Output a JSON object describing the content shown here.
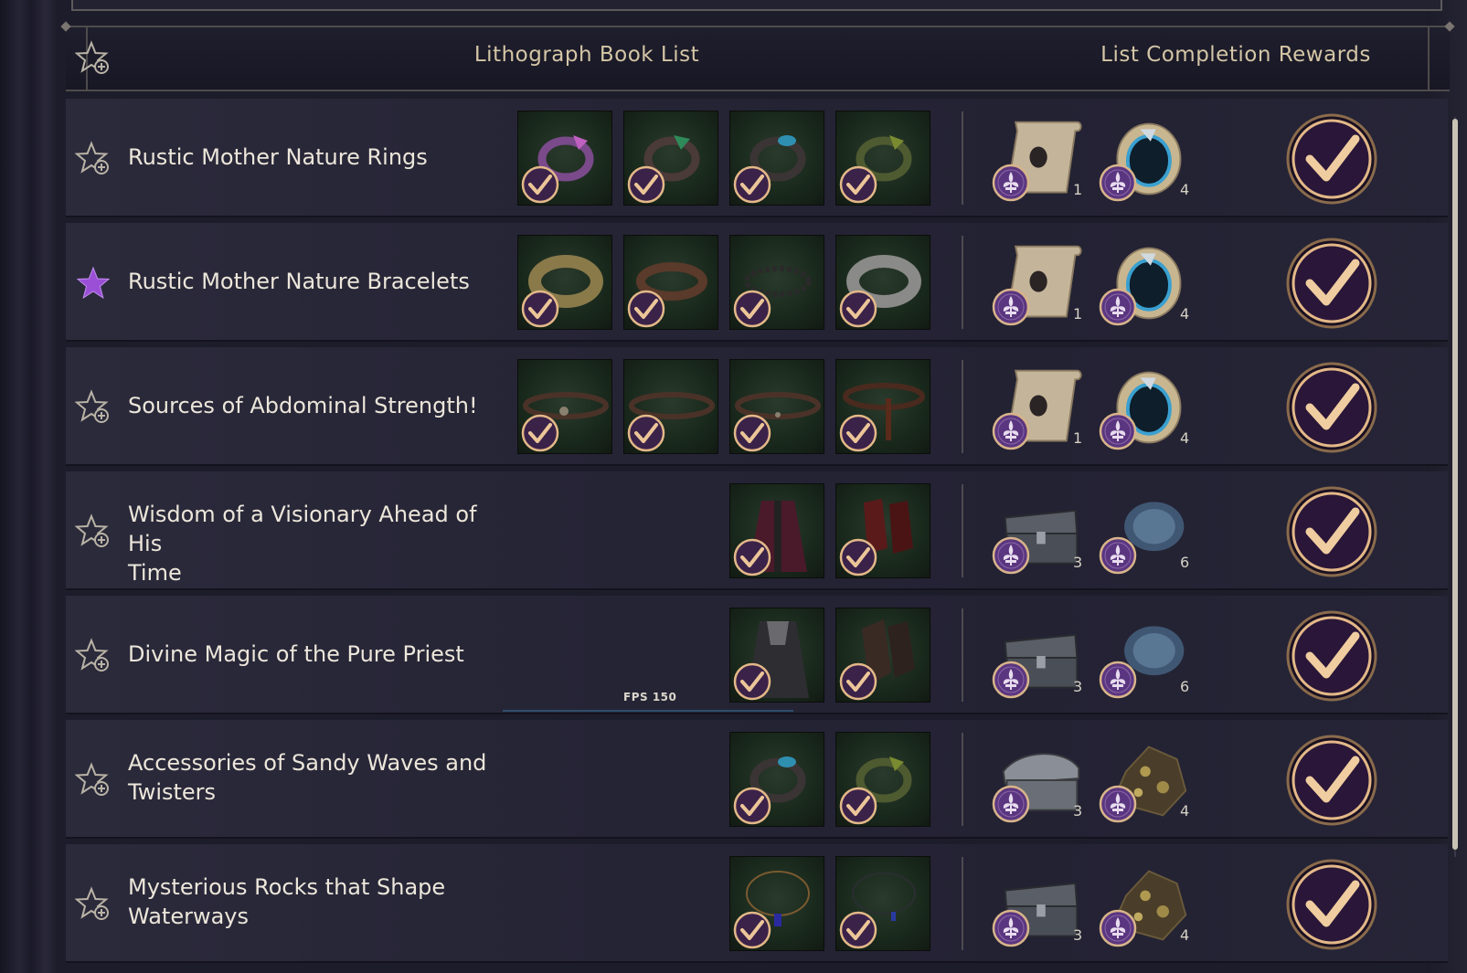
{
  "header": {
    "title": "Lithograph Book List",
    "rewards_title": "List Completion Rewards",
    "star_icon": "star-plus-icon"
  },
  "overlay": {
    "fps_label": "FPS",
    "fps_value": "150"
  },
  "colors": {
    "accent_gold": "#e3b888",
    "badge_purple": "#6a3f8f",
    "favorite_star": "#9b4fd6",
    "claim_circle": "#2a1638"
  },
  "rows": [
    {
      "title_lines": [
        "Rustic Mother Nature Rings"
      ],
      "favorite": false,
      "items": [
        "ring-purple-icon",
        "ring-green-icon",
        "ring-blue-icon",
        "ring-olive-icon"
      ],
      "rewards": [
        {
          "icon": "lithograph-scroll-icon",
          "count": "1"
        },
        {
          "icon": "blue-ring-icon",
          "count": "4"
        }
      ]
    },
    {
      "title_lines": [
        "Rustic Mother Nature Bracelets"
      ],
      "favorite": true,
      "items": [
        "bracelet-gold-icon",
        "bracelet-leather-icon",
        "bracelet-beads-icon",
        "bracelet-silver-icon"
      ],
      "rewards": [
        {
          "icon": "lithograph-scroll-icon",
          "count": "1"
        },
        {
          "icon": "blue-ring-icon",
          "count": "4"
        }
      ]
    },
    {
      "title_lines": [
        "Sources of Abdominal Strength!"
      ],
      "favorite": false,
      "items": [
        "belt-ornate-icon",
        "belt-plain-icon",
        "belt-studded-icon",
        "belt-sash-icon"
      ],
      "rewards": [
        {
          "icon": "lithograph-scroll-icon",
          "count": "1"
        },
        {
          "icon": "blue-ring-icon",
          "count": "4"
        }
      ]
    },
    {
      "title_lines": [
        "Wisdom of a Visionary Ahead of His",
        "Time"
      ],
      "favorite": false,
      "items": [
        "coat-red-icon",
        "gloves-red-icon"
      ],
      "rewards": [
        {
          "icon": "treasure-chest-icon",
          "count": "3"
        },
        {
          "icon": "blue-ore-icon",
          "count": "6"
        }
      ]
    },
    {
      "title_lines": [
        "Divine Magic of the Pure Priest"
      ],
      "favorite": false,
      "items": [
        "robe-dark-icon",
        "gauntlet-dark-icon"
      ],
      "rewards": [
        {
          "icon": "treasure-chest-icon",
          "count": "3"
        },
        {
          "icon": "blue-ore-icon",
          "count": "6"
        }
      ]
    },
    {
      "title_lines": [
        "Accessories of Sandy Waves and",
        "Twisters"
      ],
      "favorite": false,
      "items": [
        "ring-blue-icon",
        "ring-olive-icon"
      ],
      "rewards": [
        {
          "icon": "silver-chest-icon",
          "count": "3"
        },
        {
          "icon": "gold-ore-icon",
          "count": "4"
        }
      ]
    },
    {
      "title_lines": [
        "Mysterious Rocks that Shape",
        "Waterways"
      ],
      "favorite": false,
      "items": [
        "necklace-gold-icon",
        "necklace-dark-icon"
      ],
      "rewards": [
        {
          "icon": "treasure-chest-icon",
          "count": "3"
        },
        {
          "icon": "gold-ore-icon",
          "count": "4"
        }
      ]
    }
  ]
}
